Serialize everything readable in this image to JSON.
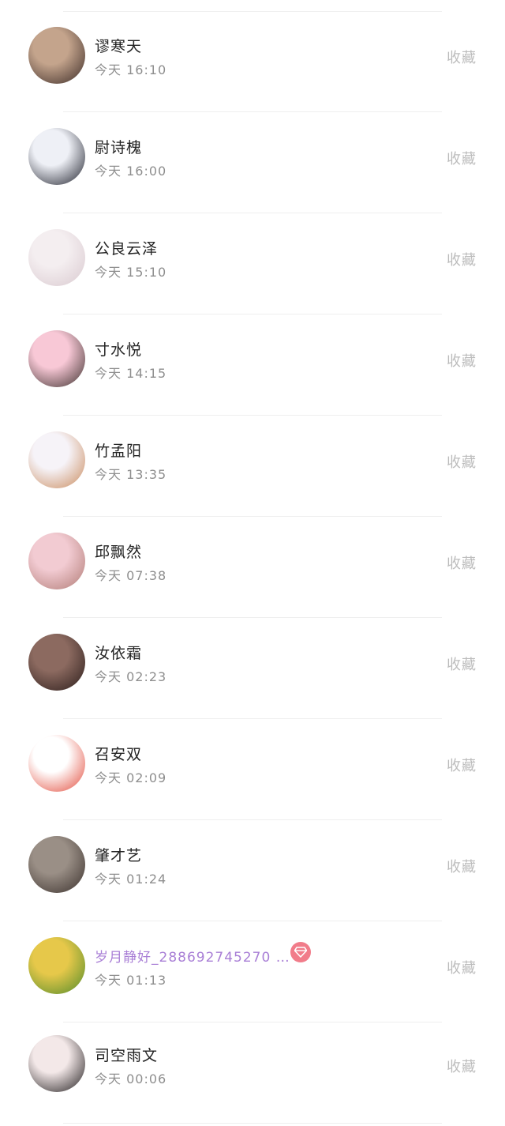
{
  "contacts": [
    {
      "name": "谬寒天",
      "time": "今天 16:10",
      "action": "收藏",
      "avatar_colors": [
        "#c4a48c",
        "#3a2a26"
      ]
    },
    {
      "name": "尉诗槐",
      "time": "今天 16:00",
      "action": "收藏",
      "avatar_colors": [
        "#eef0f6",
        "#1d1f2a"
      ]
    },
    {
      "name": "公良云泽",
      "time": "今天 15:10",
      "action": "收藏",
      "avatar_colors": [
        "#f4eef0",
        "#d9c9cf"
      ]
    },
    {
      "name": "寸水悦",
      "time": "今天 14:15",
      "action": "收藏",
      "avatar_colors": [
        "#f8c8d6",
        "#3b2f2c"
      ]
    },
    {
      "name": "竹孟阳",
      "time": "今天 13:35",
      "action": "收藏",
      "avatar_colors": [
        "#f6f3f8",
        "#c98a5c"
      ]
    },
    {
      "name": "邱飘然",
      "time": "今天 07:38",
      "action": "收藏",
      "avatar_colors": [
        "#f2cbd2",
        "#b07a74"
      ]
    },
    {
      "name": "汝依霜",
      "time": "今天 02:23",
      "action": "收藏",
      "avatar_colors": [
        "#8c6a60",
        "#2a1c1a"
      ]
    },
    {
      "name": "召安双",
      "time": "今天 02:09",
      "action": "收藏",
      "avatar_colors": [
        "#ffffff",
        "#e24a3a"
      ]
    },
    {
      "name": "肇才艺",
      "time": "今天 01:24",
      "action": "收藏",
      "avatar_colors": [
        "#9a8f86",
        "#3a302c"
      ]
    },
    {
      "name": "岁月静好_288692745270 …",
      "time": "今天 01:13",
      "action": "收藏",
      "avatar_colors": [
        "#e6c84a",
        "#4f8a2a"
      ],
      "vip": true,
      "badge_icon": "diamond-icon",
      "name_color": "#a97fd6",
      "badge_color": "#f17c8a"
    },
    {
      "name": "司空雨文",
      "time": "今天 00:06",
      "action": "收藏",
      "avatar_colors": [
        "#f3e8e8",
        "#1f1b1c"
      ]
    }
  ]
}
